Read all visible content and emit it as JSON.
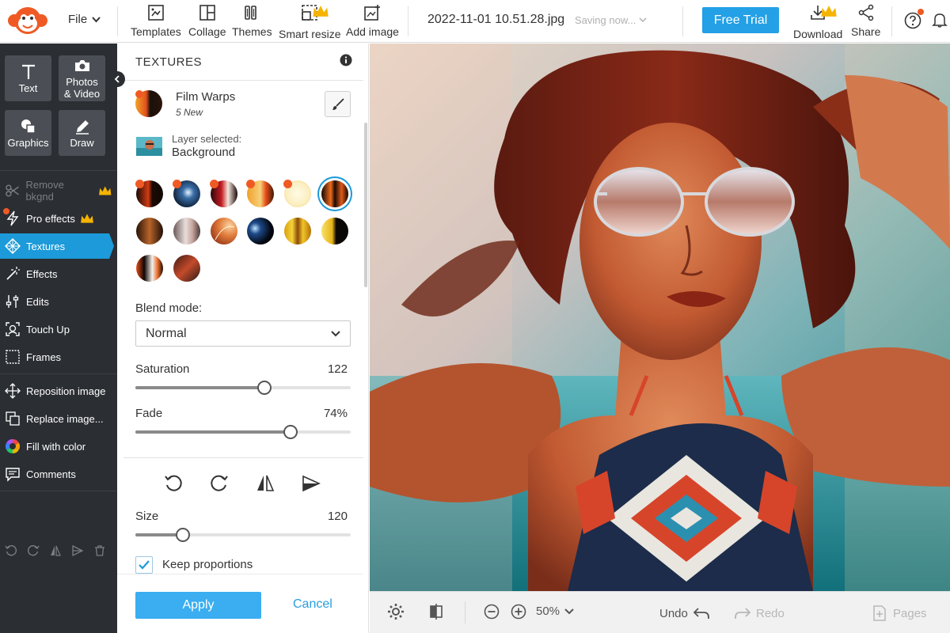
{
  "topbar": {
    "file_label": "File",
    "tools": [
      {
        "label": "Templates"
      },
      {
        "label": "Collage"
      },
      {
        "label": "Themes"
      },
      {
        "label": "Smart resize"
      },
      {
        "label": "Add image"
      }
    ],
    "filename": "2022-11-01 10.51.28.jpg",
    "saving_status": "Saving now...",
    "free_trial_label": "Free Trial",
    "download_label": "Download",
    "share_label": "Share"
  },
  "sidebar": {
    "big_buttons": [
      {
        "label": "Text"
      },
      {
        "label": "Photos & Video"
      },
      {
        "label": "Graphics"
      },
      {
        "label": "Draw"
      }
    ],
    "items": [
      {
        "label": "Remove bkgnd"
      },
      {
        "label": "Pro effects"
      },
      {
        "label": "Textures"
      },
      {
        "label": "Effects"
      },
      {
        "label": "Edits"
      },
      {
        "label": "Touch Up"
      },
      {
        "label": "Frames"
      },
      {
        "label": "Reposition image"
      },
      {
        "label": "Replace image..."
      },
      {
        "label": "Fill with color"
      },
      {
        "label": "Comments"
      }
    ]
  },
  "panel": {
    "title": "TEXTURES",
    "texture_pack": {
      "title": "Film Warps",
      "subtitle": "5 New"
    },
    "layer": {
      "label": "Layer selected:",
      "value": "Background"
    },
    "blend_mode": {
      "label": "Blend mode:",
      "value": "Normal"
    },
    "saturation": {
      "label": "Saturation",
      "value": "122",
      "fraction": 0.6
    },
    "fade": {
      "label": "Fade",
      "value": "74%",
      "fraction": 0.72
    },
    "size": {
      "label": "Size",
      "value": "120",
      "fraction": 0.22
    },
    "keep_proportions": {
      "label": "Keep proportions",
      "checked": true
    },
    "apply_label": "Apply",
    "cancel_label": "Cancel"
  },
  "bottombar": {
    "zoom": "50%",
    "undo_label": "Undo",
    "redo_label": "Redo",
    "pages_label": "Pages"
  },
  "colors": {
    "accent": "#1c9ad9",
    "free_trial": "#23a0e6",
    "apply": "#3aaef0",
    "sidebar_bg": "#2b2e33",
    "new_dot": "#ef5a24",
    "crown": "#f5b400"
  }
}
